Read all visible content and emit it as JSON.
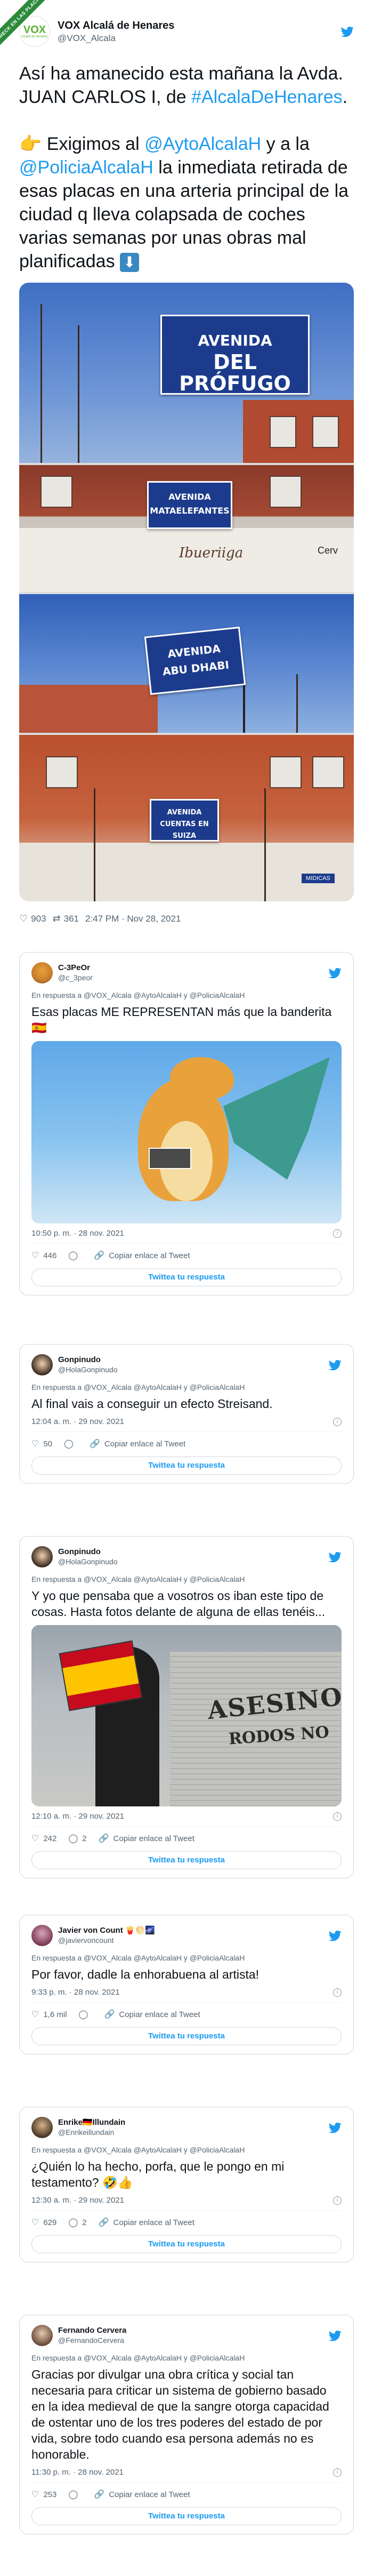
{
  "badge": {
    "text": "CHECK EN LAS PLACAS"
  },
  "main_tweet": {
    "name": "VOX Alcalá de Henares",
    "handle": "@VOX_Alcala",
    "avatar_text": "VOX",
    "avatar_sub": "Alcalá de Henares",
    "paragraph1": "Así ha amanecido esta mañana la Avda. JUAN CARLOS I, de ",
    "hashtag1": "#AlcalaDeHenares",
    "paragraph1_end": ".",
    "paragraph2_emoji": "👉",
    "paragraph2_a": " Exigimos al ",
    "mention1": "@AytoAlcalaH",
    "paragraph2_b": " y a la ",
    "mention2": "@PoliciaAlcalaH",
    "paragraph2_c": " la inmediata retirada de esas placas en una arteria principal de la ciudad q lleva colapsada de coches varias semanas por unas obras mal planificadas ",
    "arrow_emoji": "⬇",
    "photos": {
      "sign1_top": "AVENIDA",
      "sign1_bottom": "DEL PRÓFUGO",
      "sign2_top": "AVENIDA",
      "sign2_bottom": "MATAELEFANTES",
      "shop_text": "Ibueriiga",
      "shop_text2": "Cerv",
      "sign3_top": "AVENIDA",
      "sign3_bottom": "ABU DHABI",
      "sign4_top": "AVENIDA",
      "sign4_bottom": "CUENTAS EN SUIZA",
      "shop4_text": "MIDICAS"
    },
    "likes": "903",
    "retweets": "361",
    "timestamp": "2:47 PM · Nov 28, 2021"
  },
  "replies": [
    {
      "name": "C-3PeOr",
      "handle": "@c_3peor",
      "reply_to": "En respuesta a @VOX_Alcala @AytoAlcalaH y @PoliciaAlcalaH",
      "text": "Esas placas ME REPRESENTAN más que la banderita 🇪🇸",
      "time": "10:50 p. m. · 28 nov. 2021",
      "likes": "446",
      "replies_count": "",
      "copy_link": "Copiar enlace al Tweet",
      "reply_button": "Twittea tu respuesta"
    },
    {
      "name": "Gonpinudo",
      "handle": "@HolaGonpinudo",
      "reply_to": "En respuesta a @VOX_Alcala @AytoAlcalaH y @PoliciaAlcalaH",
      "text": "Al final vais a conseguir un efecto Streisand.",
      "time": "12:04 a. m. · 29 nov. 2021",
      "likes": "50",
      "replies_count": "",
      "copy_link": "Copiar enlace al Tweet",
      "reply_button": "Twittea tu respuesta"
    },
    {
      "name": "Gonpinudo",
      "handle": "@HolaGonpinudo",
      "reply_to": "En respuesta a @VOX_Alcala @AytoAlcalaH y @PoliciaAlcalaH",
      "text": "Y yo que pensaba que a vosotros os iban este tipo de cosas. Hasta fotos delante de alguna de ellas tenéis...",
      "graffiti1": "ASESINO",
      "graffiti2": "RODOS NO",
      "time": "12:10 a. m. · 29 nov. 2021",
      "likes": "242",
      "replies_count": "2",
      "copy_link": "Copiar enlace al Tweet",
      "reply_button": "Twittea tu respuesta"
    },
    {
      "name": "Javier von Count 🍟🌕🌌",
      "handle": "@javiervoncount",
      "reply_to": "En respuesta a @VOX_Alcala @AytoAlcalaH y @PoliciaAlcalaH",
      "text": "Por favor, dadle la enhorabuena al artista!",
      "time": "9:33 p. m. · 28 nov. 2021",
      "likes": "1,6 mil",
      "replies_count": "",
      "copy_link": "Copiar enlace al Tweet",
      "reply_button": "Twittea tu respuesta"
    },
    {
      "name": "Enrike🇩🇪Illundain",
      "handle": "@Enrikeillundain",
      "reply_to": "En respuesta a @VOX_Alcala @AytoAlcalaH y @PoliciaAlcalaH",
      "text": "¿Quién lo ha hecho, porfa, que le pongo en mi testamento? 🤣👍",
      "time": "12:30 a. m. · 29 nov. 2021",
      "likes": "629",
      "replies_count": "2",
      "copy_link": "Copiar enlace al Tweet",
      "reply_button": "Twittea tu respuesta"
    },
    {
      "name": "Fernando Cervera",
      "handle": "@FernandoCervera",
      "reply_to": "En respuesta a @VOX_Alcala @AytoAlcalaH y @PoliciaAlcalaH",
      "text": "Gracias por divulgar una obra crítica y social tan necesaria para criticar un sistema de gobierno basado en la idea medieval de que la sangre otorga capacidad de ostentar uno de los tres poderes del estado de por vida, sobre todo cuando esa persona además no es honorable.",
      "time": "11:30 p. m. · 28 nov. 2021",
      "likes": "253",
      "replies_count": "",
      "copy_link": "Copiar enlace al Tweet",
      "reply_button": "Twittea tu respuesta"
    }
  ],
  "colors": {
    "twitter_blue": "#1d9bf0",
    "text_primary": "#0f1419",
    "text_secondary": "#536471",
    "border": "#cfd9de",
    "vox_green": "#5cb031"
  },
  "icons": [
    "twitter-bird-icon",
    "heart-icon",
    "retweet-icon",
    "reply-icon",
    "link-icon",
    "info-icon"
  ]
}
